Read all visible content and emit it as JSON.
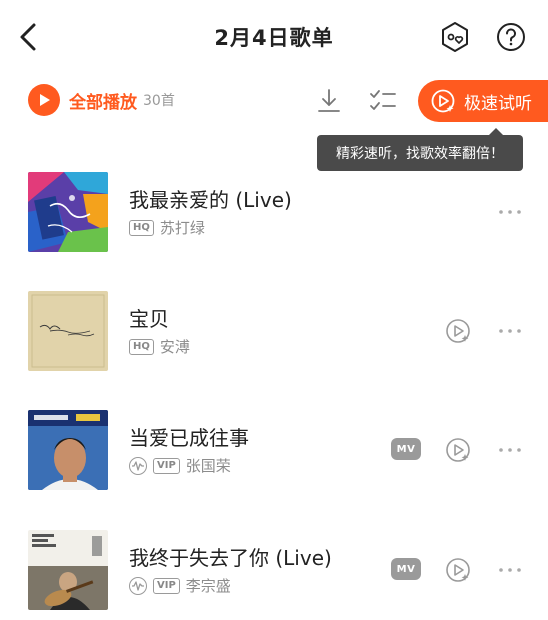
{
  "header": {
    "title": "2月4日歌单",
    "back_icon": "chevron-left-icon",
    "skin_icon": "skin-hexagon-icon",
    "help_icon": "question-circle-icon"
  },
  "toolbar": {
    "play_all_label": "全部播放",
    "song_count": "30首",
    "download_icon": "download-icon",
    "multi_select_icon": "multi-select-icon",
    "fast_listen_label": "极速试听"
  },
  "tooltip": {
    "text": "精彩速听，找歌效率翻倍！"
  },
  "songs": [
    {
      "title": "我最亲爱的 (Live)",
      "artist": "苏打绿",
      "quality_tag": "HQ",
      "vip_tag": "",
      "has_mv": false,
      "has_preview": false
    },
    {
      "title": "宝贝",
      "artist": "安溥",
      "quality_tag": "HQ",
      "vip_tag": "",
      "has_mv": false,
      "has_preview": true
    },
    {
      "title": "当爱已成往事",
      "artist": "张国荣",
      "quality_tag": "",
      "vip_tag": "VIP",
      "has_mv": true,
      "has_preview": true
    },
    {
      "title": "我终于失去了你 (Live)",
      "artist": "李宗盛",
      "quality_tag": "",
      "vip_tag": "VIP",
      "has_mv": true,
      "has_preview": true
    }
  ],
  "labels": {
    "mv": "MV"
  },
  "colors": {
    "accent": "#ff5a1f",
    "tooltip_bg": "#4a4a4a",
    "secondary_text": "#8c8c8c"
  }
}
